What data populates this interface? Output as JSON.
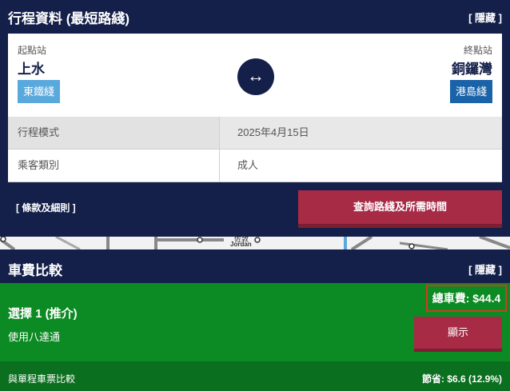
{
  "journey": {
    "title": "行程資料 (最短路綫)",
    "hide_label": "[ 隱藏 ]",
    "origin": {
      "label": "起點站",
      "station": "上水",
      "line": "東鐵綫",
      "line_color": "#5aa9dd"
    },
    "destination": {
      "label": "終點站",
      "station": "銅鑼灣",
      "line": "港島綫",
      "line_color": "#1a63a8"
    },
    "swap_icon": "↔",
    "rows": [
      {
        "label": "行程模式",
        "value": "2025年4月15日"
      },
      {
        "label": "乘客類別",
        "value": "成人"
      }
    ],
    "terms_link": "[ 條款及細則 ]",
    "query_button": "查詢路綫及所需時間"
  },
  "map_strip": {
    "station_en": "Jordan",
    "station_zh": "佐敦"
  },
  "fares": {
    "title": "車費比較",
    "hide_label": "[ 隱藏 ]",
    "option_title": "選擇 1 (推介)",
    "option_sub": "使用八達通",
    "total": "總車費: $44.4",
    "show_button": "顯示",
    "compare_label": "與單程車票比較",
    "saving": "節省: $6.6 (12.9%)"
  }
}
